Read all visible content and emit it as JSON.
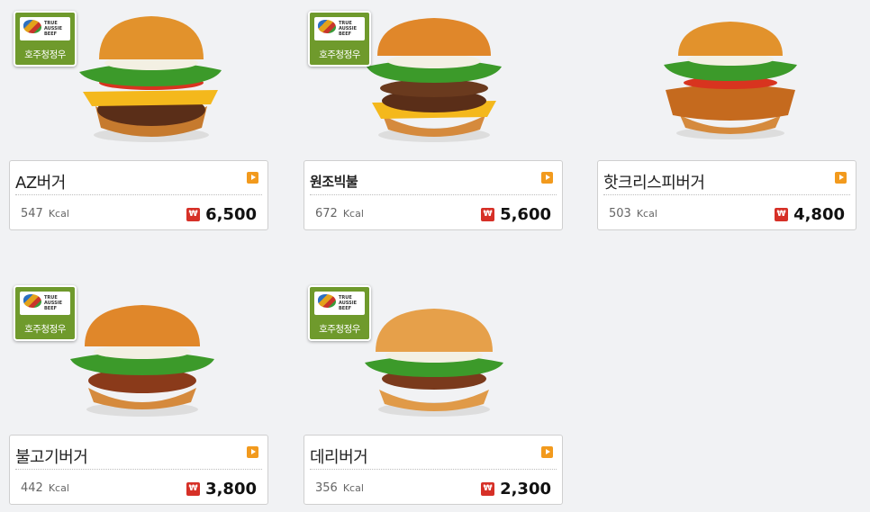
{
  "badge": {
    "label": "호주청정우",
    "flag_text": "TRUE AUSSIE BEEF"
  },
  "currency_icon": "won-sign-icon",
  "kcal_unit": "Kcal",
  "items": [
    {
      "name": "AZ버거",
      "kcal": "547",
      "price": "6,500",
      "has_badge": true
    },
    {
      "name": "원조빅불",
      "kcal": "672",
      "price": "5,600",
      "has_badge": true
    },
    {
      "name": "핫크리스피버거",
      "kcal": "503",
      "price": "4,800",
      "has_badge": false
    },
    {
      "name": "불고기버거",
      "kcal": "442",
      "price": "3,800",
      "has_badge": true
    },
    {
      "name": "데리버거",
      "kcal": "356",
      "price": "2,300",
      "has_badge": true
    }
  ],
  "colors": {
    "badge": "#6f9a2c",
    "arrow": "#f29a1d",
    "won": "#d63027"
  }
}
